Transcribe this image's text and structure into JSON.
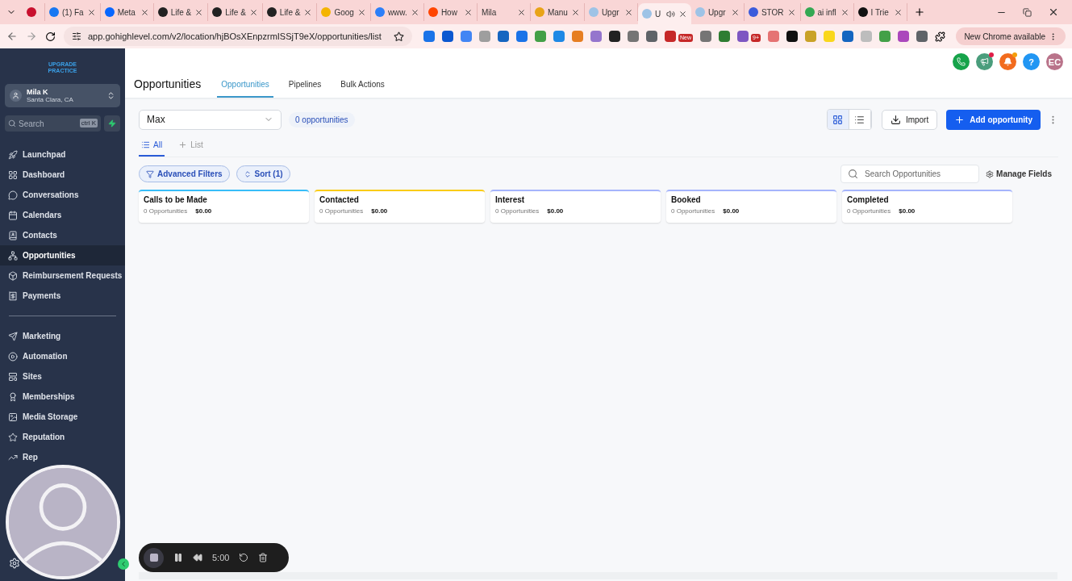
{
  "browser": {
    "tabs": [
      {
        "color": "#c8102e",
        "selected": false
      },
      {
        "title": "(1) Fa",
        "color": "#1877f2",
        "selected": false
      },
      {
        "title": "Meta",
        "color": "#0866ff",
        "selected": false
      },
      {
        "title": "Life &",
        "color": "#222222",
        "selected": false
      },
      {
        "title": "Life &",
        "color": "#222222",
        "selected": false
      },
      {
        "title": "Life &",
        "color": "#222222",
        "selected": false
      },
      {
        "title": "Goog",
        "color": "#f4b400",
        "selected": false
      },
      {
        "title": "www.",
        "color": "#2d7ff9",
        "selected": false
      },
      {
        "title": "How",
        "color": "#ff4500",
        "selected": false
      },
      {
        "title": "Mila",
        "selected": false
      },
      {
        "title": "Manu",
        "color": "#e8a317",
        "selected": false
      },
      {
        "title": "Upgr",
        "color": "#9ec3e6",
        "selected": false
      },
      {
        "title": "U",
        "color": "#9ec3e6",
        "selected": true
      },
      {
        "title": "Upgr",
        "color": "#9ec3e6",
        "selected": false
      },
      {
        "title": "STOR",
        "color": "#3b5bdb",
        "selected": false
      },
      {
        "title": "ai infl",
        "color": "#34a853",
        "selected": false
      },
      {
        "title": "I Trie",
        "color": "#111111",
        "selected": false
      }
    ],
    "url": "app.gohighlevel.com/v2/location/hjBOsXEnpzrmISSjT9eX/opportunities/list",
    "extensions": [
      {
        "color": "#1a73e8"
      },
      {
        "color": "#0b57d0"
      },
      {
        "color": "#4285f4"
      },
      {
        "color": "#9e9e9e"
      },
      {
        "color": "#1565c0"
      },
      {
        "color": "#1a73e8"
      },
      {
        "color": "#43a047"
      },
      {
        "color": "#1e88e5"
      },
      {
        "color": "#e67e22"
      },
      {
        "color": "#9575cd"
      },
      {
        "color": "#222222"
      },
      {
        "color": "#757575"
      },
      {
        "color": "#5f6368"
      },
      {
        "color": "#c62828",
        "badge": "New"
      },
      {
        "color": "#757575"
      },
      {
        "color": "#2e7d32"
      },
      {
        "color": "#7e57c2",
        "badge": "9+"
      },
      {
        "color": "#e57373"
      },
      {
        "color": "#111111"
      },
      {
        "color": "#c9a227"
      },
      {
        "color": "#f9d71c"
      },
      {
        "color": "#1565c0"
      },
      {
        "color": "#bdbdbd"
      },
      {
        "color": "#43a047"
      },
      {
        "color": "#ab47bc"
      },
      {
        "color": "#5f6368"
      }
    ],
    "update_button": "New Chrome available"
  },
  "sidebar": {
    "logo": "UPGRADE PRACTICE",
    "account": {
      "name": "Mila K",
      "location": "Santa Clara, CA"
    },
    "search": {
      "placeholder": "Search",
      "shortcut": "ctrl K"
    },
    "groups": [
      [
        {
          "label": "Launchpad",
          "selected": false
        },
        {
          "label": "Dashboard",
          "selected": false
        },
        {
          "label": "Conversations",
          "selected": false
        },
        {
          "label": "Calendars",
          "selected": false
        },
        {
          "label": "Contacts",
          "selected": false
        },
        {
          "label": "Opportunities",
          "selected": true
        },
        {
          "label": "Reimbursement Requests",
          "selected": false
        },
        {
          "label": "Payments",
          "selected": false
        }
      ],
      [
        {
          "label": "Marketing",
          "selected": false
        },
        {
          "label": "Automation",
          "selected": false
        },
        {
          "label": "Sites",
          "selected": false
        },
        {
          "label": "Memberships",
          "selected": false
        },
        {
          "label": "Media Storage",
          "selected": false
        },
        {
          "label": "Reputation",
          "selected": false
        },
        {
          "label": "Rep",
          "selected": false
        }
      ]
    ]
  },
  "header": {
    "title": "Opportunities",
    "tabs": [
      {
        "label": "Opportunities",
        "selected": true
      },
      {
        "label": "Pipelines",
        "selected": false
      },
      {
        "label": "Bulk Actions",
        "selected": false
      }
    ],
    "help": "?",
    "avatar": "EC"
  },
  "toolbar": {
    "pipeline": "Max",
    "count": "0 opportunities",
    "views": [
      {
        "kind": "grid",
        "selected": true
      },
      {
        "kind": "list",
        "selected": false
      }
    ],
    "import": "Import",
    "add": "Add opportunity"
  },
  "views": [
    {
      "label": "All",
      "selected": true
    },
    {
      "label": "List",
      "selected": false
    }
  ],
  "filters": {
    "advanced": "Advanced Filters",
    "sort": "Sort (1)",
    "search_placeholder": "Search Opportunities",
    "manage": "Manage Fields"
  },
  "stages": [
    {
      "name": "Calls to be Made",
      "count": "0 Opportunities",
      "value": "$0.00",
      "color": "#38bdf8"
    },
    {
      "name": "Contacted",
      "count": "0 Opportunities",
      "value": "$0.00",
      "color": "#facc15"
    },
    {
      "name": "Interest",
      "count": "0 Opportunities",
      "value": "$0.00",
      "color": "#a5b4fc"
    },
    {
      "name": "Booked",
      "count": "0 Opportunities",
      "value": "$0.00",
      "color": "#a5b4fc"
    },
    {
      "name": "Completed",
      "count": "0 Opportunities",
      "value": "$0.00",
      "color": "#a5b4fc"
    }
  ],
  "recorder": {
    "time": "5:00"
  }
}
